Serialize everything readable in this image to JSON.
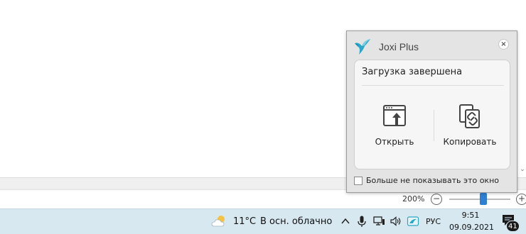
{
  "statusbar": {
    "zoom_level": "200%",
    "zoom_minus": "−",
    "zoom_plus": "+"
  },
  "taskbar": {
    "weather_temp": "11°C",
    "weather_text": "В осн. облачно",
    "language": "РУС",
    "time": "9:51",
    "date": "09.09.2021",
    "notification_count": "41",
    "tray_chevron": "^"
  },
  "joxi": {
    "title": "Joxi Plus",
    "close": "×",
    "status": "Загрузка завершена",
    "open_label": "Открыть",
    "copy_label": "Копировать",
    "dont_show_label": "Больше не показывать это окно",
    "dont_show_checked": false
  },
  "colors": {
    "accent": "#2d7fd3",
    "taskbar": "#d7e8f1",
    "logo": "#2aa8c9"
  }
}
